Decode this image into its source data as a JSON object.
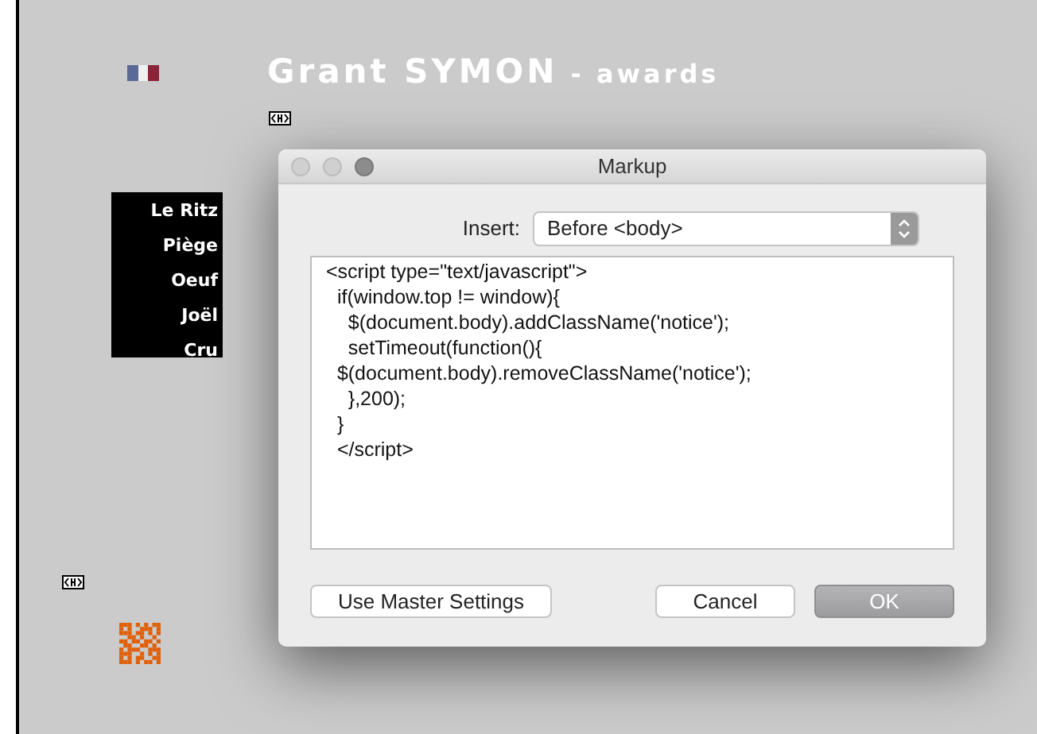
{
  "site": {
    "title": "Grant SYMON",
    "subtitle": "- awards",
    "menu": [
      "Le Ritz",
      "Piège",
      "Oeuf",
      "Joël",
      "Cru"
    ]
  },
  "dialog": {
    "title": "Markup",
    "insert_label": "Insert:",
    "insert_value": "Before <body>",
    "code": [
      "<script type=\"text/javascript\">",
      "  if(window.top != window){",
      "    $(document.body).addClassName('notice');",
      "    setTimeout(function(){",
      "  $(document.body).removeClassName('notice');",
      "    },200);",
      "  }",
      "  </script>"
    ],
    "buttons": [
      {
        "label": "Use Master Settings",
        "kind": "secondary"
      },
      {
        "label": "Cancel",
        "kind": "cancel"
      },
      {
        "label": "OK",
        "kind": "default"
      }
    ]
  }
}
